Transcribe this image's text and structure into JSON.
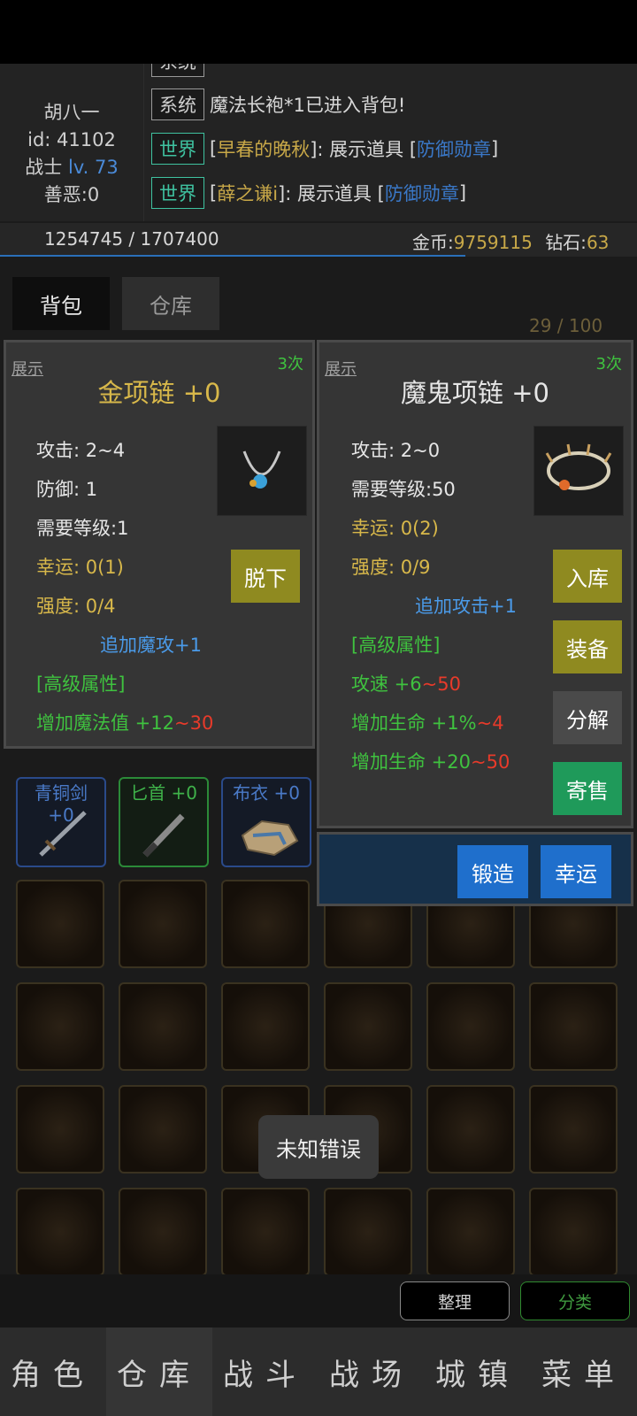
{
  "player": {
    "name": "胡八一",
    "id": "id: 41102",
    "class": "战士",
    "level": "lv. 73",
    "karma": "善恶:0"
  },
  "chat": {
    "top_partial": "系统",
    "messages": [
      {
        "channel": "系统",
        "text": "魔法长袍*1已进入背包!"
      },
      {
        "channel": "世界",
        "prefix": "[",
        "name": "早春的晚秋",
        "mid": "]: 展示道具 [",
        "item": "防御勋章",
        "suffix": "]"
      },
      {
        "channel": "世界",
        "prefix": "[",
        "name": "薛之谦i",
        "mid": "]: 展示道具 [",
        "item": "防御勋章",
        "suffix": "]"
      }
    ]
  },
  "exp": {
    "text": "1254745 / 1707400",
    "fraction": 0.73
  },
  "currency": {
    "gold_label": "金币:",
    "gold": "9759115",
    "diamond_label": "钻石:",
    "diamond": "63"
  },
  "tabs": {
    "bag": "背包",
    "warehouse": "仓库"
  },
  "capacity": "29 / 100",
  "left_panel": {
    "show": "展示",
    "count": "3次",
    "title": "金项链 +0",
    "attack": "攻击: 2~4",
    "defense": "防御: 1",
    "level_req": "需要等级:1",
    "luck": "幸运: 0(1)",
    "strength": "强度: 0/4",
    "bonus": "追加魔攻+1",
    "advanced": "[高级属性]",
    "adv1_text": "增加魔法值 +12",
    "adv1_range": "~30",
    "unequip": "脱下"
  },
  "right_panel": {
    "show": "展示",
    "count": "3次",
    "title": "魔鬼项链 +0",
    "attack": "攻击: 2~0",
    "level_req": "需要等级:50",
    "luck": "幸运: 0(2)",
    "strength": "强度: 0/9",
    "bonus": "追加攻击+1",
    "advanced": "[高级属性]",
    "adv1_text": "攻速 +6",
    "adv1_range": "~50",
    "adv2_text": "增加生命 +1%",
    "adv2_range": "~4",
    "adv3_text": "增加生命 +20",
    "adv3_range": "~50",
    "store": "入库",
    "equip": "装备",
    "decompose": "分解",
    "sell": "寄售",
    "forge": "锻造",
    "lucky": "幸运"
  },
  "items": [
    {
      "name": "青铜剑",
      "plus": "+0"
    },
    {
      "name": "匕首",
      "plus": "+0"
    },
    {
      "name": "布衣",
      "plus": "+0"
    }
  ],
  "toast": "未知错误",
  "sort_buttons": {
    "sort": "整理",
    "classify": "分类"
  },
  "nav": [
    "角色",
    "仓库",
    "战斗",
    "战场",
    "城镇",
    "菜单"
  ],
  "colors": {
    "gold": "#c8a848",
    "green": "#3fc23f",
    "red": "#e83a2a",
    "blue": "#4a9ae8",
    "olive_button": "#8f8a20"
  }
}
